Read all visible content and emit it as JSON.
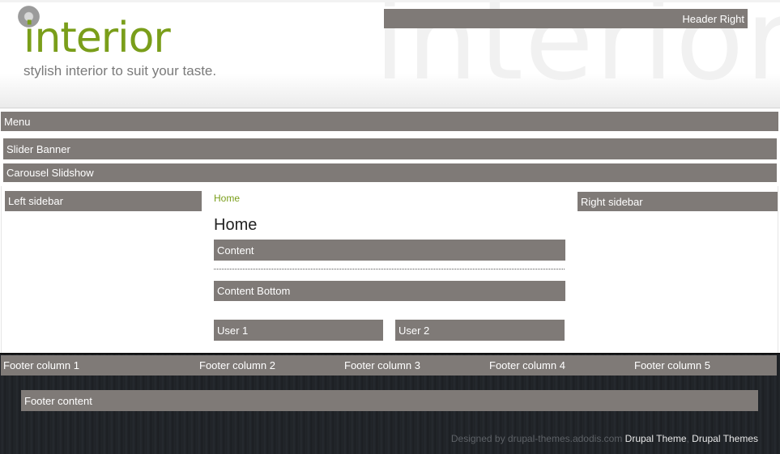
{
  "header": {
    "watermark": "interior",
    "logo_text": "interior",
    "slogan": "stylish interior to suit your taste.",
    "header_right": "Header Right"
  },
  "nav": {
    "menu": "Menu"
  },
  "regions": {
    "slider_banner": "Slider Banner",
    "carousel_slideshow": "Carousel Slidshow",
    "left_sidebar": "Left sidebar",
    "right_sidebar": "Right sidebar",
    "content": "Content",
    "content_bottom": "Content Bottom",
    "user1": "User 1",
    "user2": "User 2"
  },
  "main": {
    "breadcrumb": "Home",
    "title": "Home"
  },
  "footer": {
    "columns": [
      "Footer column 1",
      "Footer column 2",
      "Footer column 3",
      "Footer column 4",
      "Footer column 5"
    ],
    "content": "Footer content",
    "credit_prefix": "Designed by drupal-themes.adodis.com",
    "link_drupal_theme": "Drupal Theme",
    "separator": ", ",
    "link_drupal_themes": "Drupal Themes"
  },
  "colors": {
    "accent": "#7a9e1a",
    "region_block": "#7f7a77",
    "footer_bg": "#23272b"
  }
}
